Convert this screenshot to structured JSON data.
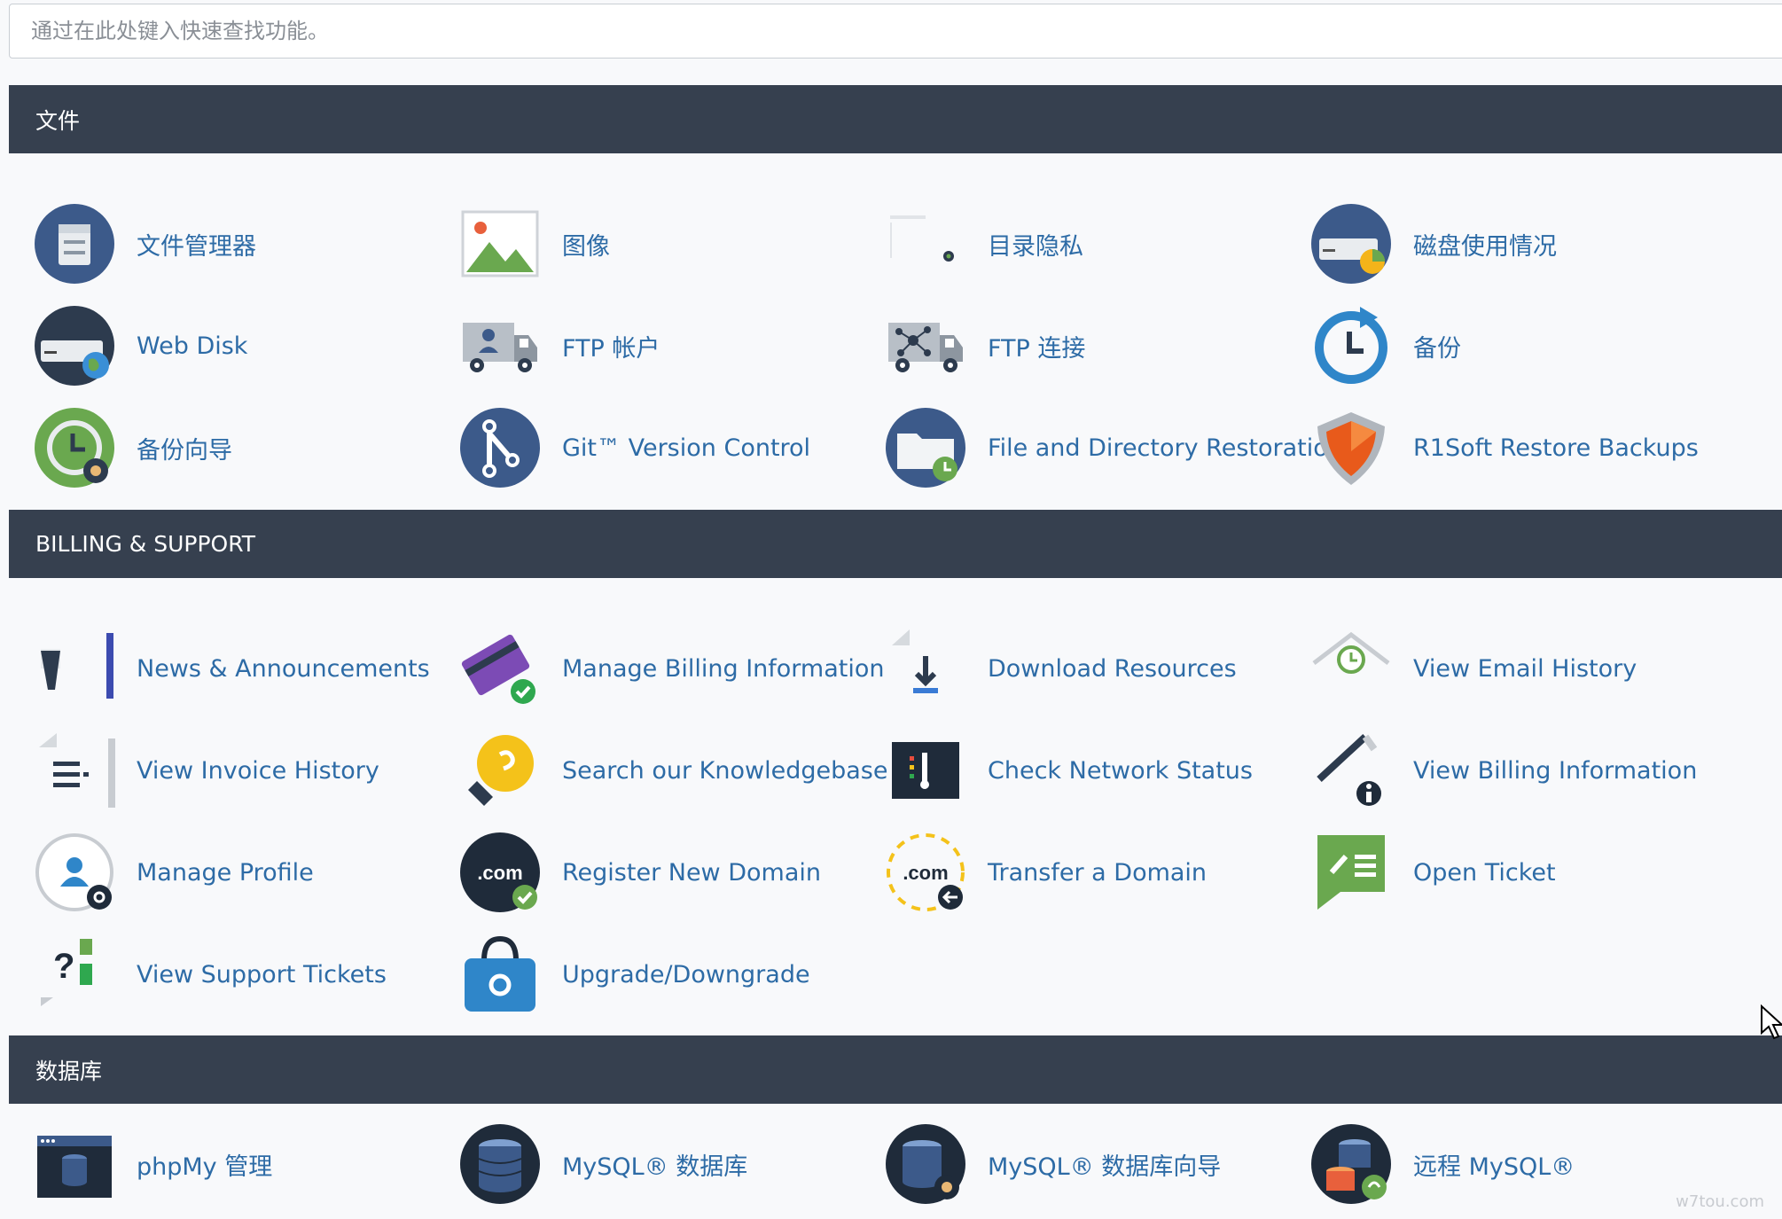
{
  "search": {
    "placeholder": "通过在此处键入快速查找功能。"
  },
  "sections": {
    "files": {
      "title": "文件",
      "items": [
        {
          "label": "文件管理器",
          "icon": "file-manager-icon"
        },
        {
          "label": "图像",
          "icon": "images-icon"
        },
        {
          "label": "目录隐私",
          "icon": "directory-privacy-icon"
        },
        {
          "label": "磁盘使用情况",
          "icon": "disk-usage-icon"
        },
        {
          "label": "Web Disk",
          "icon": "web-disk-icon"
        },
        {
          "label": "FTP 帐户",
          "icon": "ftp-accounts-icon"
        },
        {
          "label": "FTP 连接",
          "icon": "ftp-connections-icon"
        },
        {
          "label": "备份",
          "icon": "backup-icon"
        },
        {
          "label": "备份向导",
          "icon": "backup-wizard-icon"
        },
        {
          "label": "Git™ Version Control",
          "icon": "git-icon"
        },
        {
          "label": "File and Directory Restoration",
          "icon": "file-restore-icon"
        },
        {
          "label": "R1Soft Restore Backups",
          "icon": "r1soft-shield-icon"
        }
      ]
    },
    "billing": {
      "title": "BILLING & SUPPORT",
      "items": [
        {
          "label": "News & Announcements",
          "icon": "megaphone-icon"
        },
        {
          "label": "Manage Billing Information",
          "icon": "credit-card-icon"
        },
        {
          "label": "Download Resources",
          "icon": "download-icon"
        },
        {
          "label": "View Email History",
          "icon": "email-history-icon"
        },
        {
          "label": "View Invoice History",
          "icon": "invoice-icon"
        },
        {
          "label": "Search our Knowledgebase",
          "icon": "lightbulb-icon"
        },
        {
          "label": "Check Network Status",
          "icon": "network-status-icon"
        },
        {
          "label": "View Billing Information",
          "icon": "billing-info-icon"
        },
        {
          "label": "Manage Profile",
          "icon": "profile-icon"
        },
        {
          "label": "Register New Domain",
          "icon": "register-domain-icon"
        },
        {
          "label": "Transfer a Domain",
          "icon": "transfer-domain-icon"
        },
        {
          "label": "Open Ticket",
          "icon": "open-ticket-icon"
        },
        {
          "label": "View Support Tickets",
          "icon": "support-tickets-icon"
        },
        {
          "label": "Upgrade/Downgrade",
          "icon": "upgrade-bag-icon"
        }
      ]
    },
    "databases": {
      "title": "数据库",
      "items": [
        {
          "label": "phpMy 管理",
          "icon": "phpmyadmin-icon"
        },
        {
          "label": "MySQL® 数据库",
          "icon": "mysql-database-icon"
        },
        {
          "label": "MySQL® 数据库向导",
          "icon": "mysql-wizard-icon"
        },
        {
          "label": "远程 MySQL®",
          "icon": "remote-mysql-icon"
        }
      ]
    }
  },
  "watermark": "w7tou.com",
  "colors": {
    "header": "#36404f",
    "link": "#2d6ba6",
    "icon_blue": "#3c5a8a"
  }
}
